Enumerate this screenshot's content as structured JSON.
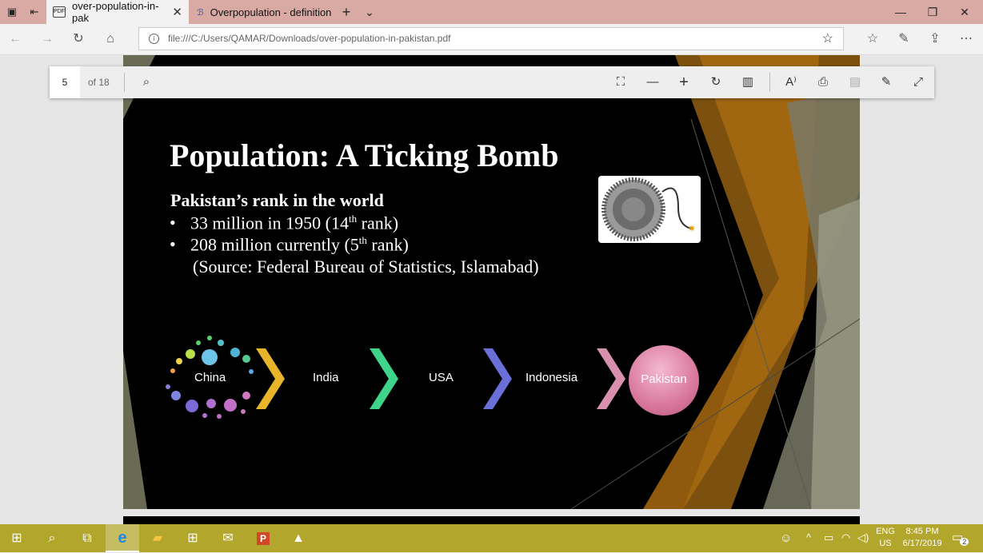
{
  "browser": {
    "tabs": [
      {
        "label": "over-population-in-pak"
      },
      {
        "label": "Overpopulation - definition"
      }
    ],
    "address": "file:///C:/Users/QAMAR/Downloads/over-population-in-pakistan.pdf",
    "new_tab_glyph": "+",
    "tab_list_glyph": "⌄"
  },
  "pdf_toolbar": {
    "page": "5",
    "of_pages": "of 18"
  },
  "slide": {
    "title": "Population: A Ticking Bomb",
    "subtitle": "Pakistan’s rank in the world",
    "bullet1_pre": "33 million in 1950 (14",
    "bullet1_sup": "th",
    "bullet1_post": " rank)",
    "bullet2_pre": "208 million currently (5",
    "bullet2_sup": "th",
    "bullet2_post": " rank)",
    "source": "(Source: Federal Bureau of Statistics, Islamabad)",
    "flow": [
      "China",
      "India",
      "USA",
      "Indonesia",
      "Pakistan"
    ],
    "chevron_colors": [
      "#e8b52a",
      "#3ed48a",
      "#6b6fd8",
      "#d98fae"
    ]
  },
  "taskbar": {
    "lang": "ENG",
    "region": "US",
    "time": "8:45 PM",
    "date": "6/17/2019",
    "notif_count": "2"
  },
  "icons": [
    "windows-icon",
    "search-icon",
    "task-view-icon",
    "edge-icon",
    "file-explorer-icon",
    "store-icon",
    "mail-icon",
    "powerpoint-icon",
    "photos-icon"
  ]
}
